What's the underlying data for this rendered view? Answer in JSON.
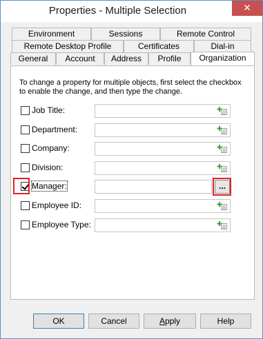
{
  "window": {
    "title": "Properties - Multiple Selection",
    "close_glyph": "✕"
  },
  "tabs": {
    "row1": [
      "Environment",
      "Sessions",
      "Remote Control"
    ],
    "row2": [
      "Remote Desktop Profile",
      "Certificates",
      "Dial-in"
    ],
    "row3": [
      "General",
      "Account",
      "Address",
      "Profile",
      "Organization"
    ],
    "active": "Organization"
  },
  "description": "To change a property for multiple objects, first select the checkbox to enable the change, and then type the change.",
  "fields": [
    {
      "label": "Job Title:",
      "checked": false,
      "value": "",
      "action_icon": "add-to-list-icon"
    },
    {
      "label": "Department:",
      "checked": false,
      "value": "",
      "action_icon": "add-to-list-icon"
    },
    {
      "label": "Company:",
      "checked": false,
      "value": "",
      "action_icon": "add-to-list-icon"
    },
    {
      "label": "Division:",
      "checked": false,
      "value": "",
      "action_icon": "add-to-list-icon"
    },
    {
      "label": "Manager:",
      "checked": true,
      "value": "",
      "action_label": "..."
    },
    {
      "label": "Employee ID:",
      "checked": false,
      "value": "",
      "action_icon": "add-to-list-icon"
    },
    {
      "label": "Employee Type:",
      "checked": false,
      "value": "",
      "action_icon": "add-to-list-icon"
    }
  ],
  "buttons": {
    "ok": "OK",
    "cancel": "Cancel",
    "apply": "Apply",
    "help": "Help"
  },
  "colors": {
    "highlight": "#e0202a",
    "title_close": "#c75050"
  }
}
